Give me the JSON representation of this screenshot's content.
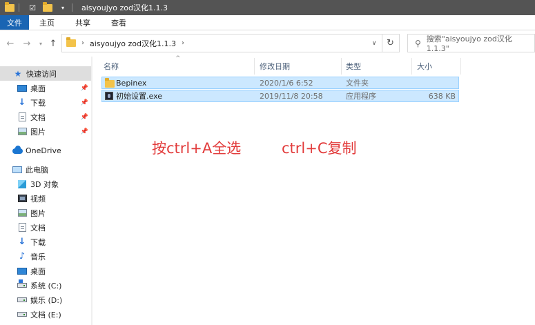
{
  "window": {
    "title": "aisyoujyo zod汉化1.1.3"
  },
  "ribbon": {
    "tabs": [
      "文件",
      "主页",
      "共享",
      "查看"
    ]
  },
  "address": {
    "crumb": "aisyoujyo zod汉化1.1.3",
    "search_placeholder": "搜索\"aisyoujyo zod汉化1.1.3\""
  },
  "sidebar": {
    "items": [
      {
        "label": "快速访问",
        "icon": "star-icon",
        "pinned": false
      },
      {
        "label": "桌面",
        "icon": "desktop-icon",
        "pinned": true
      },
      {
        "label": "下载",
        "icon": "download-icon",
        "pinned": true
      },
      {
        "label": "文档",
        "icon": "document-icon",
        "pinned": true
      },
      {
        "label": "图片",
        "icon": "picture-icon",
        "pinned": true
      },
      {
        "label": "OneDrive",
        "icon": "cloud-icon",
        "pinned": false
      },
      {
        "label": "此电脑",
        "icon": "computer-icon",
        "pinned": false
      },
      {
        "label": "3D 对象",
        "icon": "3d-objects-icon",
        "pinned": false
      },
      {
        "label": "视频",
        "icon": "video-icon",
        "pinned": false
      },
      {
        "label": "图片",
        "icon": "picture-icon",
        "pinned": false
      },
      {
        "label": "文档",
        "icon": "document-icon",
        "pinned": false
      },
      {
        "label": "下载",
        "icon": "download-icon",
        "pinned": false
      },
      {
        "label": "音乐",
        "icon": "music-icon",
        "pinned": false
      },
      {
        "label": "桌面",
        "icon": "desktop-icon",
        "pinned": false
      },
      {
        "label": "系统 (C:)",
        "icon": "system-drive-icon",
        "pinned": false
      },
      {
        "label": "娱乐 (D:)",
        "icon": "drive-icon",
        "pinned": false
      },
      {
        "label": "文档 (E:)",
        "icon": "drive-icon",
        "pinned": false
      }
    ]
  },
  "columns": {
    "name": "名称",
    "date": "修改日期",
    "type": "类型",
    "size": "大小"
  },
  "files": [
    {
      "name": "Bepinex",
      "date": "2020/1/6 6:52",
      "type": "文件夹",
      "size": "",
      "icon": "folder-icon"
    },
    {
      "name": "初始设置.exe",
      "date": "2019/11/8 20:58",
      "type": "应用程序",
      "size": "638 KB",
      "icon": "exe-icon"
    }
  ],
  "annotation": {
    "left": "按ctrl+A全选",
    "right": "ctrl+C复制",
    "color": "#e23b3b"
  },
  "colors": {
    "file_tab": "#1a65b3",
    "title_bar": "#545454",
    "selection": "#cce8ff"
  }
}
